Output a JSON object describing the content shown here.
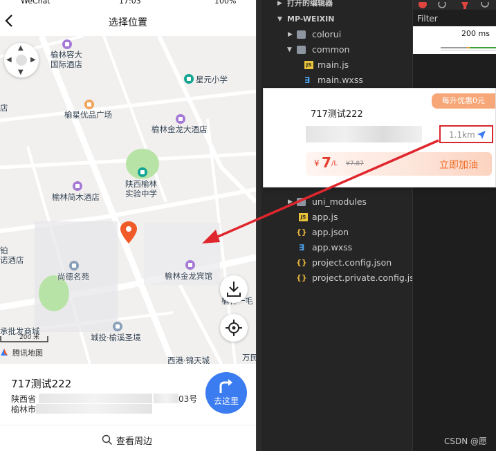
{
  "status_bar": {
    "left": "WeChat",
    "time": "17:03",
    "battery": "100%"
  },
  "navbar": {
    "title": "选择位置",
    "back_icon": "chevron-left-icon"
  },
  "map": {
    "pois": [
      {
        "label": "榆林容大\n国际酒店",
        "kind": "hotel"
      },
      {
        "label": "星元小学",
        "kind": "school"
      },
      {
        "label": "店",
        "kind": "text"
      },
      {
        "label": "榆星优品广场",
        "kind": "shop"
      },
      {
        "label": "榆林金龙大酒店",
        "kind": "hotel"
      },
      {
        "label": "陕西榆林\n实验中学",
        "kind": "school"
      },
      {
        "label": "榆林简木酒店",
        "kind": "hotel"
      },
      {
        "label": "铂\n诺酒店",
        "kind": "text"
      },
      {
        "label": "尚德名苑",
        "kind": "res"
      },
      {
        "label": "榆林金龙宾馆",
        "kind": "hotel"
      },
      {
        "label": "榆林一毛",
        "kind": "text"
      },
      {
        "label": "承批发商城",
        "kind": "text"
      },
      {
        "label": "城投·榆溪圣境",
        "kind": "res"
      },
      {
        "label": "西港·锦天城",
        "kind": "text"
      },
      {
        "label": "万民",
        "kind": "text"
      }
    ],
    "scale_label": "200 米",
    "brand": "腾讯地图"
  },
  "bottom_card": {
    "name": "717测试222",
    "address_line1_start": "陕西省",
    "address_line1_end": "03号",
    "address_line2_start": "榆林市",
    "go_label": "去这里"
  },
  "bottom_bar": {
    "label": "查看周边"
  },
  "ide": {
    "sections": [
      {
        "label": "打开的编辑器",
        "expanded": false
      },
      {
        "label": "MP-WEIXIN",
        "expanded": true
      }
    ],
    "tree": [
      {
        "label": "colorui",
        "type": "folder",
        "expanded": false
      },
      {
        "label": "common",
        "type": "folder",
        "expanded": true
      },
      {
        "label": "main.js",
        "type": "js"
      },
      {
        "label": "main.wxss",
        "type": "css"
      },
      {
        "label": "uni_modules",
        "type": "folder",
        "expanded": false
      },
      {
        "label": "app.js",
        "type": "js"
      },
      {
        "label": "app.json",
        "type": "json"
      },
      {
        "label": "app.wxss",
        "type": "css"
      },
      {
        "label": "project.config.json",
        "type": "json"
      },
      {
        "label": "project.private.config.js...",
        "type": "json"
      }
    ],
    "devtools": {
      "filter": "Filter",
      "timing": "200 ms"
    }
  },
  "card": {
    "badge": "每升优惠0元",
    "name": "717测试222",
    "distance": "1.1km",
    "price_currency": "¥",
    "price": "7",
    "price_unit": "/L",
    "old_price": "¥7.87",
    "action": "立即加油"
  },
  "watermark": "CSDN @愿",
  "colors": {
    "accent_blue": "#3b7cf0",
    "highlight_red": "#d8262d",
    "price_red": "#e33d2e",
    "badge_orange": "#f7a677"
  }
}
